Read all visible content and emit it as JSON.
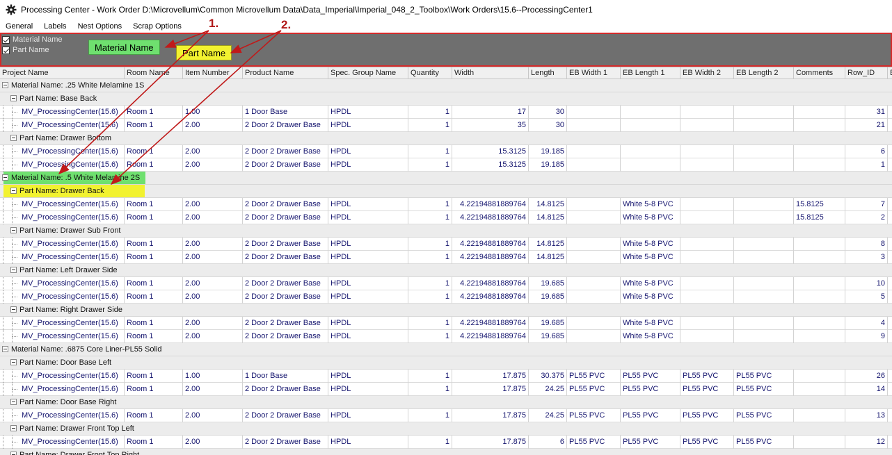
{
  "window": {
    "title": "Processing Center - Work Order D:\\Microvellum\\Common Microvellum Data\\Data_Imperial\\Imperial_048_2_Toolbox\\Work Orders\\15.6--ProcessingCenter1"
  },
  "menu": [
    {
      "label": "General"
    },
    {
      "label": "Labels"
    },
    {
      "label": "Nest Options"
    },
    {
      "label": "Scrap Options"
    }
  ],
  "group_panel": {
    "checkboxes": [
      {
        "label": "Material Name",
        "checked": true
      },
      {
        "label": "Part Name",
        "checked": true
      }
    ],
    "chips": [
      {
        "label": "Material Name",
        "color": "#6fe06f"
      },
      {
        "label": "Part Name",
        "color": "#f2f230"
      }
    ],
    "border_color": "#d42a2a"
  },
  "annotations": [
    {
      "label": "1."
    },
    {
      "label": "2."
    }
  ],
  "columns": [
    "Project Name",
    "Room Name",
    "Item Number",
    "Product Name",
    "Spec. Group Name",
    "Quantity",
    "Width",
    "Length",
    "EB Width 1",
    "EB Length 1",
    "EB Width 2",
    "EB Length 2",
    "Comments",
    "Row_ID",
    "B"
  ],
  "rows": [
    {
      "kind": "mat",
      "label": "Material Name: .25 White Melamine 1S"
    },
    {
      "kind": "part",
      "label": "Part Name: Base Back"
    },
    {
      "kind": "data",
      "cells": [
        "MV_ProcessingCenter(15.6)",
        "Room 1",
        "1.00",
        "1 Door Base",
        "HPDL",
        "1",
        "17",
        "30",
        "",
        "",
        "",
        "",
        "",
        "31"
      ]
    },
    {
      "kind": "data",
      "cells": [
        "MV_ProcessingCenter(15.6)",
        "Room 1",
        "2.00",
        "2 Door 2 Drawer Base",
        "HPDL",
        "1",
        "35",
        "30",
        "",
        "",
        "",
        "",
        "",
        "21"
      ]
    },
    {
      "kind": "part",
      "label": "Part Name: Drawer Bottom"
    },
    {
      "kind": "data",
      "cells": [
        "MV_ProcessingCenter(15.6)",
        "Room 1",
        "2.00",
        "2 Door 2 Drawer Base",
        "HPDL",
        "1",
        "15.3125",
        "19.185",
        "",
        "",
        "",
        "",
        "",
        "6"
      ]
    },
    {
      "kind": "data",
      "cells": [
        "MV_ProcessingCenter(15.6)",
        "Room 1",
        "2.00",
        "2 Door 2 Drawer Base",
        "HPDL",
        "1",
        "15.3125",
        "19.185",
        "",
        "",
        "",
        "",
        "",
        "1"
      ]
    },
    {
      "kind": "mat",
      "label": "Material Name: .5 White Melamine 2S",
      "highlight": "green"
    },
    {
      "kind": "part",
      "label": "Part Name: Drawer Back",
      "highlight": "yellow"
    },
    {
      "kind": "data",
      "cells": [
        "MV_ProcessingCenter(15.6)",
        "Room 1",
        "2.00",
        "2 Door 2 Drawer Base",
        "HPDL",
        "1",
        "4.22194881889764",
        "14.8125",
        "",
        "White 5-8 PVC",
        "",
        "",
        "15.8125",
        "7"
      ]
    },
    {
      "kind": "data",
      "cells": [
        "MV_ProcessingCenter(15.6)",
        "Room 1",
        "2.00",
        "2 Door 2 Drawer Base",
        "HPDL",
        "1",
        "4.22194881889764",
        "14.8125",
        "",
        "White 5-8 PVC",
        "",
        "",
        "15.8125",
        "2"
      ]
    },
    {
      "kind": "part",
      "label": "Part Name: Drawer Sub Front"
    },
    {
      "kind": "data",
      "cells": [
        "MV_ProcessingCenter(15.6)",
        "Room 1",
        "2.00",
        "2 Door 2 Drawer Base",
        "HPDL",
        "1",
        "4.22194881889764",
        "14.8125",
        "",
        "White 5-8 PVC",
        "",
        "",
        "",
        "8"
      ]
    },
    {
      "kind": "data",
      "cells": [
        "MV_ProcessingCenter(15.6)",
        "Room 1",
        "2.00",
        "2 Door 2 Drawer Base",
        "HPDL",
        "1",
        "4.22194881889764",
        "14.8125",
        "",
        "White 5-8 PVC",
        "",
        "",
        "",
        "3"
      ]
    },
    {
      "kind": "part",
      "label": "Part Name: Left Drawer Side"
    },
    {
      "kind": "data",
      "cells": [
        "MV_ProcessingCenter(15.6)",
        "Room 1",
        "2.00",
        "2 Door 2 Drawer Base",
        "HPDL",
        "1",
        "4.22194881889764",
        "19.685",
        "",
        "White 5-8 PVC",
        "",
        "",
        "",
        "10"
      ]
    },
    {
      "kind": "data",
      "cells": [
        "MV_ProcessingCenter(15.6)",
        "Room 1",
        "2.00",
        "2 Door 2 Drawer Base",
        "HPDL",
        "1",
        "4.22194881889764",
        "19.685",
        "",
        "White 5-8 PVC",
        "",
        "",
        "",
        "5"
      ]
    },
    {
      "kind": "part",
      "label": "Part Name: Right Drawer Side"
    },
    {
      "kind": "data",
      "cells": [
        "MV_ProcessingCenter(15.6)",
        "Room 1",
        "2.00",
        "2 Door 2 Drawer Base",
        "HPDL",
        "1",
        "4.22194881889764",
        "19.685",
        "",
        "White 5-8 PVC",
        "",
        "",
        "",
        "4"
      ]
    },
    {
      "kind": "data",
      "cells": [
        "MV_ProcessingCenter(15.6)",
        "Room 1",
        "2.00",
        "2 Door 2 Drawer Base",
        "HPDL",
        "1",
        "4.22194881889764",
        "19.685",
        "",
        "White 5-8 PVC",
        "",
        "",
        "",
        "9"
      ]
    },
    {
      "kind": "mat",
      "label": "Material Name: .6875 Core Liner-PL55 Solid"
    },
    {
      "kind": "part",
      "label": "Part Name: Door Base Left"
    },
    {
      "kind": "data",
      "cells": [
        "MV_ProcessingCenter(15.6)",
        "Room 1",
        "1.00",
        "1 Door Base",
        "HPDL",
        "1",
        "17.875",
        "30.375",
        "PL55 PVC",
        "PL55 PVC",
        "PL55 PVC",
        "PL55 PVC",
        "",
        "26"
      ]
    },
    {
      "kind": "data",
      "cells": [
        "MV_ProcessingCenter(15.6)",
        "Room 1",
        "2.00",
        "2 Door 2 Drawer Base",
        "HPDL",
        "1",
        "17.875",
        "24.25",
        "PL55 PVC",
        "PL55 PVC",
        "PL55 PVC",
        "PL55 PVC",
        "",
        "14"
      ]
    },
    {
      "kind": "part",
      "label": "Part Name: Door Base Right"
    },
    {
      "kind": "data",
      "cells": [
        "MV_ProcessingCenter(15.6)",
        "Room 1",
        "2.00",
        "2 Door 2 Drawer Base",
        "HPDL",
        "1",
        "17.875",
        "24.25",
        "PL55 PVC",
        "PL55 PVC",
        "PL55 PVC",
        "PL55 PVC",
        "",
        "13"
      ]
    },
    {
      "kind": "part",
      "label": "Part Name: Drawer Front Top Left"
    },
    {
      "kind": "data",
      "cells": [
        "MV_ProcessingCenter(15.6)",
        "Room 1",
        "2.00",
        "2 Door 2 Drawer Base",
        "HPDL",
        "1",
        "17.875",
        "6",
        "PL55 PVC",
        "PL55 PVC",
        "PL55 PVC",
        "PL55 PVC",
        "",
        "12"
      ]
    },
    {
      "kind": "part",
      "label": "Part Name: Drawer Front Top Right"
    }
  ]
}
